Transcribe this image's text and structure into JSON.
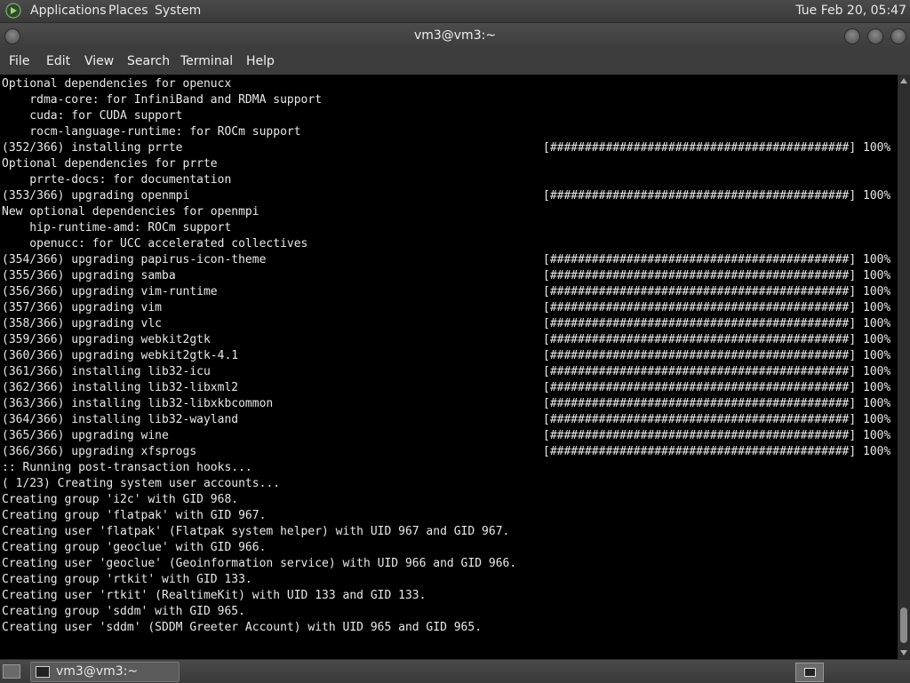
{
  "top_panel": {
    "menus": [
      "Applications",
      "Places",
      "System"
    ],
    "clock": "Tue Feb 20, 05:47"
  },
  "window": {
    "title": "vm3@vm3:~"
  },
  "menubar": [
    "File",
    "Edit",
    "View",
    "Search",
    "Terminal",
    "Help"
  ],
  "terminal": {
    "lines": [
      {
        "text": "Optional dependencies for openucx",
        "bar": ""
      },
      {
        "text": "    rdma-core: for InfiniBand and RDMA support",
        "bar": ""
      },
      {
        "text": "    cuda: for CUDA support",
        "bar": ""
      },
      {
        "text": "    rocm-language-runtime: for ROCm support",
        "bar": ""
      },
      {
        "text": "(352/366) installing prrte",
        "bar": "[###########################################] 100%"
      },
      {
        "text": "Optional dependencies for prrte",
        "bar": ""
      },
      {
        "text": "    prrte-docs: for documentation",
        "bar": ""
      },
      {
        "text": "(353/366) upgrading openmpi",
        "bar": "[###########################################] 100%"
      },
      {
        "text": "New optional dependencies for openmpi",
        "bar": ""
      },
      {
        "text": "    hip-runtime-amd: ROCm support",
        "bar": ""
      },
      {
        "text": "    openucc: for UCC accelerated collectives",
        "bar": ""
      },
      {
        "text": "(354/366) upgrading papirus-icon-theme",
        "bar": "[###########################################] 100%"
      },
      {
        "text": "(355/366) upgrading samba",
        "bar": "[###########################################] 100%"
      },
      {
        "text": "(356/366) upgrading vim-runtime",
        "bar": "[###########################################] 100%"
      },
      {
        "text": "(357/366) upgrading vim",
        "bar": "[###########################################] 100%"
      },
      {
        "text": "(358/366) upgrading vlc",
        "bar": "[###########################################] 100%"
      },
      {
        "text": "(359/366) upgrading webkit2gtk",
        "bar": "[###########################################] 100%"
      },
      {
        "text": "(360/366) upgrading webkit2gtk-4.1",
        "bar": "[###########################################] 100%"
      },
      {
        "text": "(361/366) installing lib32-icu",
        "bar": "[###########################################] 100%"
      },
      {
        "text": "(362/366) installing lib32-libxml2",
        "bar": "[###########################################] 100%"
      },
      {
        "text": "(363/366) installing lib32-libxkbcommon",
        "bar": "[###########################################] 100%"
      },
      {
        "text": "(364/366) installing lib32-wayland",
        "bar": "[###########################################] 100%"
      },
      {
        "text": "(365/366) upgrading wine",
        "bar": "[###########################################] 100%"
      },
      {
        "text": "(366/366) upgrading xfsprogs",
        "bar": "[###########################################] 100%"
      },
      {
        "text": ":: Running post-transaction hooks...",
        "bar": ""
      },
      {
        "text": "( 1/23) Creating system user accounts...",
        "bar": ""
      },
      {
        "text": "Creating group 'i2c' with GID 968.",
        "bar": ""
      },
      {
        "text": "Creating group 'flatpak' with GID 967.",
        "bar": ""
      },
      {
        "text": "Creating user 'flatpak' (Flatpak system helper) with UID 967 and GID 967.",
        "bar": ""
      },
      {
        "text": "Creating group 'geoclue' with GID 966.",
        "bar": ""
      },
      {
        "text": "Creating user 'geoclue' (Geoinformation service) with UID 966 and GID 966.",
        "bar": ""
      },
      {
        "text": "Creating group 'rtkit' with GID 133.",
        "bar": ""
      },
      {
        "text": "Creating user 'rtkit' (RealtimeKit) with UID 133 and GID 133.",
        "bar": ""
      },
      {
        "text": "Creating group 'sddm' with GID 965.",
        "bar": ""
      },
      {
        "text": "Creating user 'sddm' (SDDM Greeter Account) with UID 965 and GID 965.",
        "bar": ""
      }
    ]
  },
  "bottom_panel": {
    "task_label": "vm3@vm3:~"
  }
}
